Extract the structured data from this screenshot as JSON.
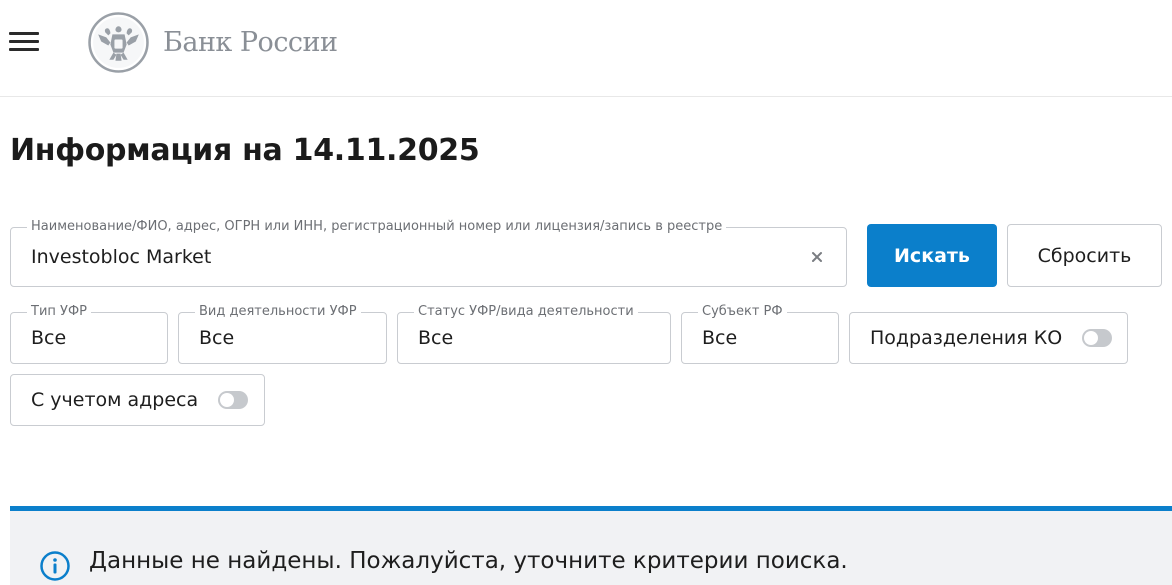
{
  "header": {
    "menu_icon": "hamburger-icon",
    "logo_icon": "double-headed-eagle-emblem",
    "logo_text": "Банк России"
  },
  "page": {
    "title": "Информация на 14.11.2025"
  },
  "search": {
    "label": "Наименование/ФИО, адрес, ОГРН или ИНН, регистрационный номер или лицензия/запись в реестре",
    "value": "Investobloc Market",
    "clear_icon": "close-icon",
    "search_button": "Искать",
    "reset_button": "Сбросить"
  },
  "filters": [
    {
      "label": "Тип УФР",
      "value": "Все"
    },
    {
      "label": "Вид деятельности УФР",
      "value": "Все"
    },
    {
      "label": "Статус УФР/вида деятельности",
      "value": "Все"
    },
    {
      "label": "Субъект РФ",
      "value": "Все"
    }
  ],
  "toggles": [
    {
      "label": "Подразделения КО",
      "on": false
    },
    {
      "label": "С учетом адреса",
      "on": false
    }
  ],
  "alert": {
    "icon": "info-icon",
    "text": "Данные не найдены. Пожалуйста, уточните критерии поиска."
  },
  "colors": {
    "accent": "#0b7fcb",
    "logo_gray": "#8a8f96",
    "alert_bg": "#f1f2f4",
    "border": "#c9ccd1"
  }
}
